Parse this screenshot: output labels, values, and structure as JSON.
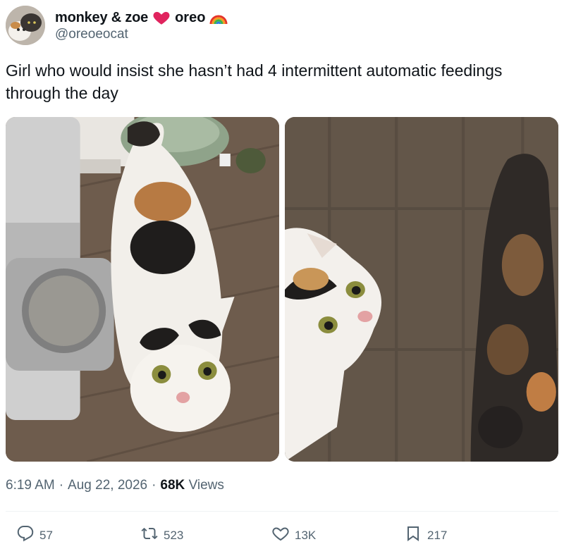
{
  "user": {
    "display_name": "monkey & zoe",
    "display_name_heart": "❤️",
    "display_name_2": "oreo",
    "display_name_rainbow": "🌈",
    "handle": "@oreoeocat"
  },
  "tweet": {
    "text": "Girl who would insist she hasn’t had 4 intermittent automatic feedings through the day"
  },
  "meta": {
    "time": "6:19 AM",
    "separator": "·",
    "date": "Aug 22, 2026",
    "separator_2": "·",
    "views_count": "68K",
    "views_label": "Views"
  },
  "actions": {
    "replies": "57",
    "reposts": "523",
    "likes": "13K",
    "bookmarks": "217"
  },
  "colors": {
    "text": "#0f1419",
    "secondary": "#536471",
    "heart": "#e0245e",
    "divider": "#eff3f4"
  }
}
